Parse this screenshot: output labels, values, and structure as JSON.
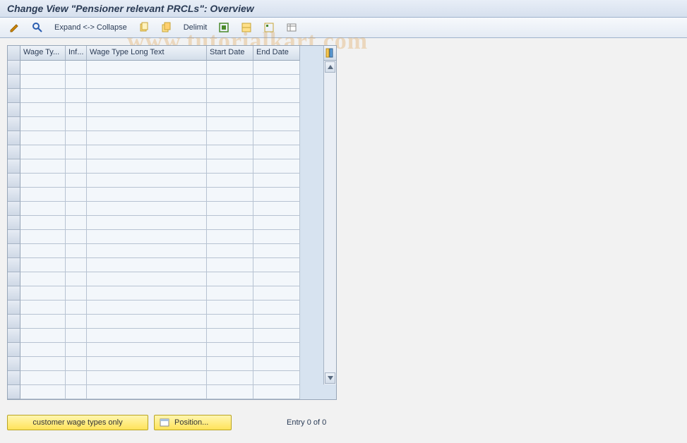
{
  "title": "Change View \"Pensioner relevant PRCLs\": Overview",
  "toolbar": {
    "expand": "Expand <-> Collapse",
    "delimit": "Delimit"
  },
  "columns": [
    "Wage Ty...",
    "Inf...",
    "Wage Type Long Text",
    "Start Date",
    "End Date"
  ],
  "rows_count": 24,
  "bottom": {
    "customer_btn": "customer wage types only",
    "position_btn": "Position...",
    "entry_text": "Entry 0 of 0"
  },
  "watermark": "www.tutorialkart.com"
}
